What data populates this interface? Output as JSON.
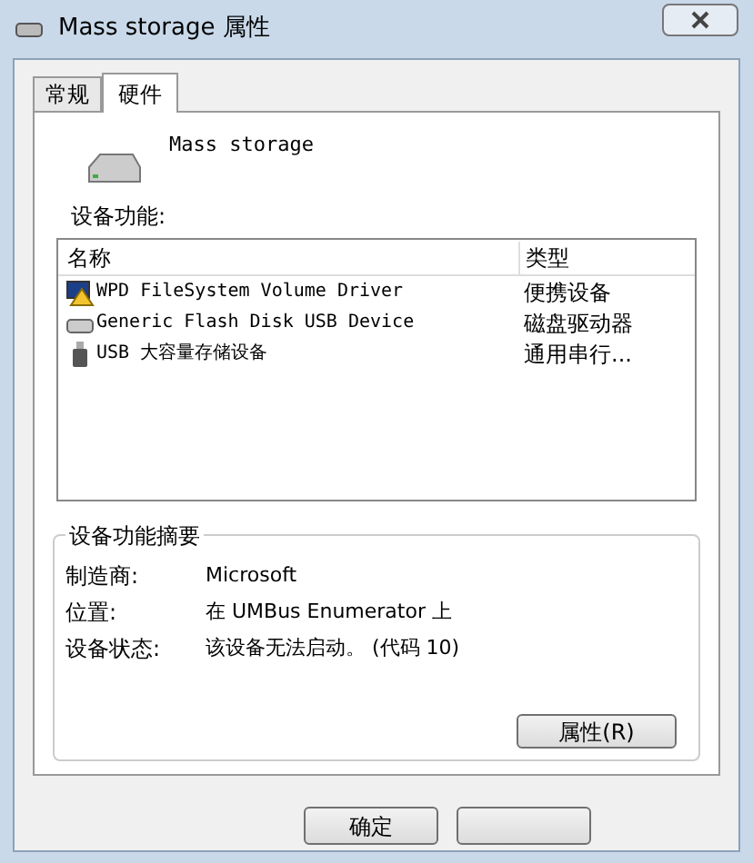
{
  "window": {
    "title": "Mass storage 属性"
  },
  "tabs": [
    {
      "label": "常规",
      "selected": false
    },
    {
      "label": "硬件",
      "selected": true
    }
  ],
  "device_name": "Mass storage",
  "functions_label": "设备功能:",
  "table": {
    "columns": [
      "名称",
      "类型"
    ],
    "rows": [
      {
        "kind": "warning",
        "name": "WPD FileSystem Volume Driver",
        "type": "便携设备"
      },
      {
        "kind": "disk",
        "name": "Generic Flash Disk USB Device",
        "type": "磁盘驱动器"
      },
      {
        "kind": "usb",
        "name": "USB 大容量存储设备",
        "type": "通用串行..."
      }
    ]
  },
  "summary": {
    "title": "设备功能摘要",
    "fields": [
      {
        "label": "制造商:",
        "value": "Microsoft"
      },
      {
        "label": "位置:",
        "value": "在 UMBus Enumerator 上"
      },
      {
        "label": "设备状态:",
        "value": "该设备无法启动。 (代码 10)"
      }
    ],
    "button": "属性(R)"
  },
  "buttons": [
    "确定"
  ]
}
